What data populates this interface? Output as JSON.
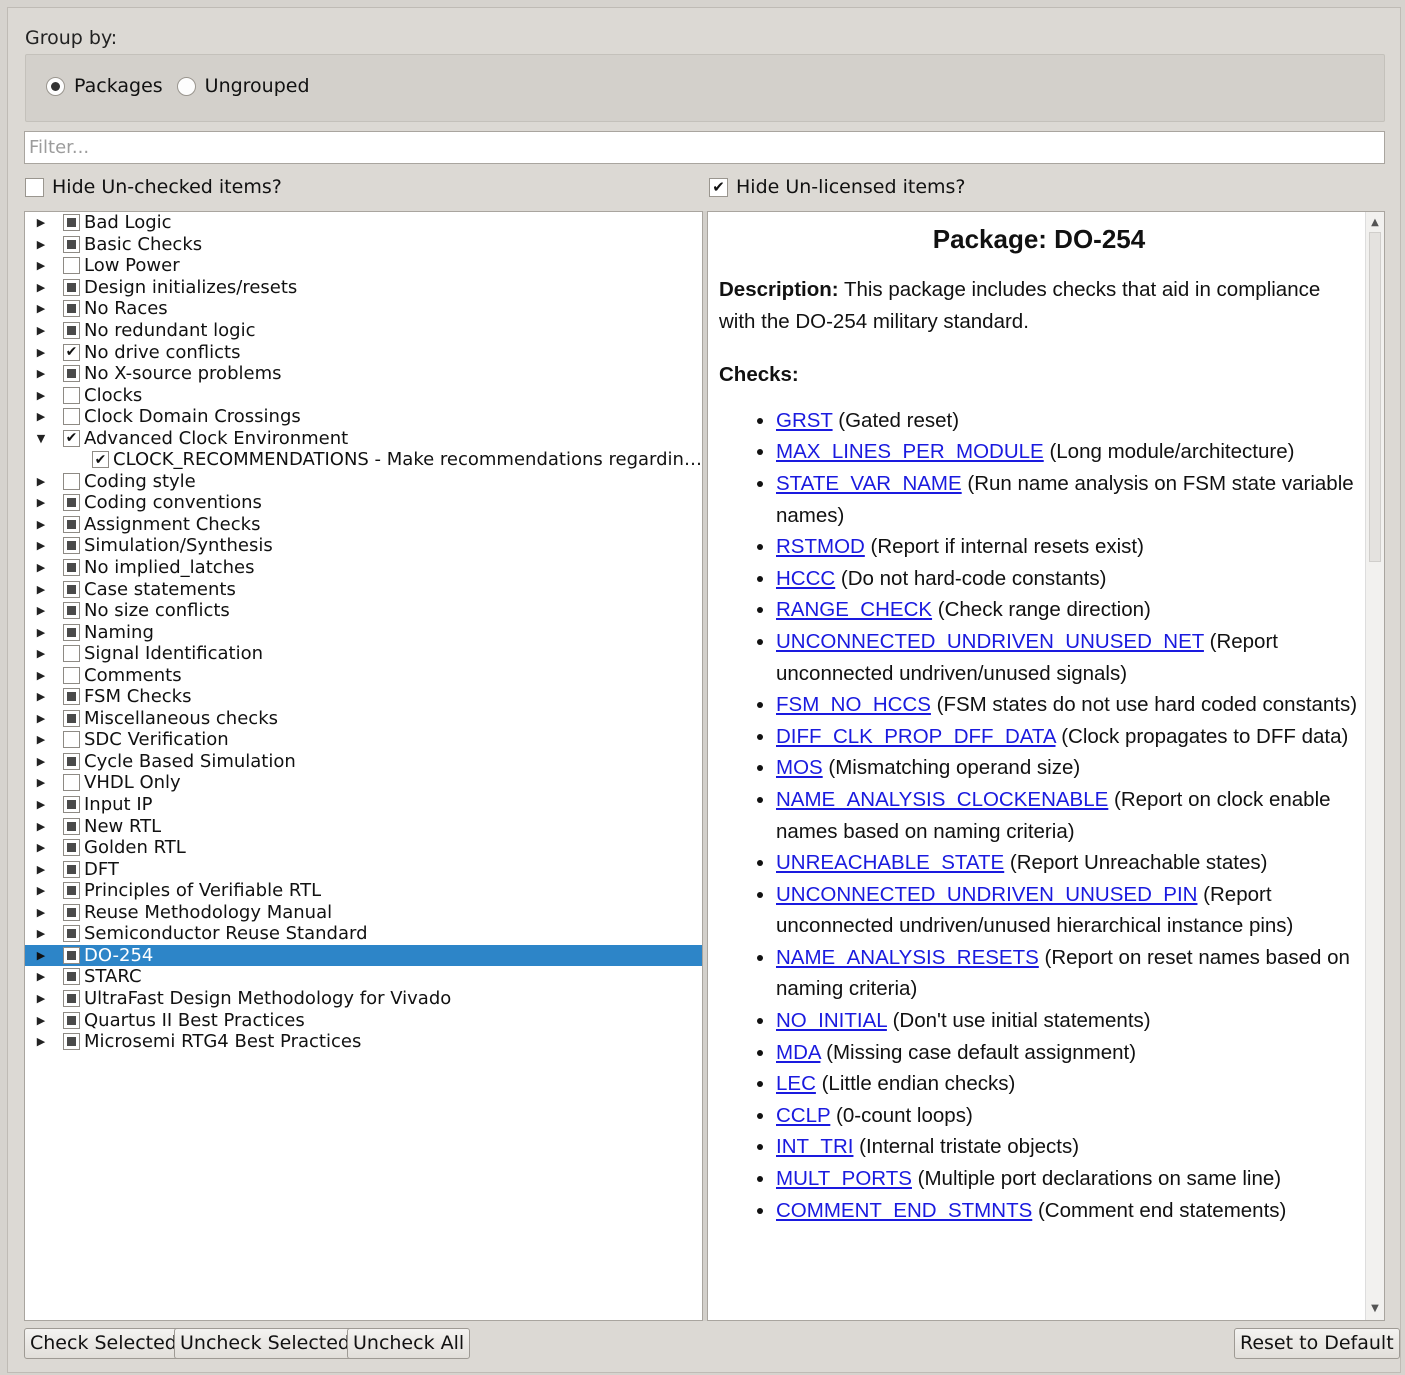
{
  "group_by": {
    "label": "Group by:",
    "options": [
      {
        "label": "Packages",
        "selected": true
      },
      {
        "label": "Ungrouped",
        "selected": false
      }
    ]
  },
  "filter": {
    "placeholder": "Filter...",
    "value": ""
  },
  "hide_unchecked": {
    "label": "Hide Un-checked items?",
    "checked": false
  },
  "hide_unlicensed": {
    "label": "Hide Un-licensed items?",
    "checked": true
  },
  "tree": [
    {
      "label": "Bad Logic",
      "state": "partial",
      "expanded": false
    },
    {
      "label": "Basic Checks",
      "state": "partial",
      "expanded": false
    },
    {
      "label": "Low Power",
      "state": "unchecked",
      "expanded": false
    },
    {
      "label": "Design initializes/resets",
      "state": "partial",
      "expanded": false
    },
    {
      "label": "No Races",
      "state": "partial",
      "expanded": false
    },
    {
      "label": "No redundant logic",
      "state": "partial",
      "expanded": false
    },
    {
      "label": "No drive conflicts",
      "state": "checked",
      "expanded": false
    },
    {
      "label": "No X-source problems",
      "state": "partial",
      "expanded": false
    },
    {
      "label": "Clocks",
      "state": "unchecked",
      "expanded": false
    },
    {
      "label": "Clock Domain Crossings",
      "state": "unchecked",
      "expanded": false
    },
    {
      "label": "Advanced Clock Environment",
      "state": "checked",
      "expanded": true,
      "children": [
        {
          "label": "CLOCK_RECOMMENDATIONS - Make recommendations regardin…",
          "state": "checked"
        }
      ]
    },
    {
      "label": "Coding style",
      "state": "unchecked",
      "expanded": false
    },
    {
      "label": "Coding conventions",
      "state": "partial",
      "expanded": false
    },
    {
      "label": "Assignment Checks",
      "state": "partial",
      "expanded": false
    },
    {
      "label": "Simulation/Synthesis",
      "state": "partial",
      "expanded": false
    },
    {
      "label": "No implied_latches",
      "state": "partial",
      "expanded": false
    },
    {
      "label": "Case statements",
      "state": "partial",
      "expanded": false
    },
    {
      "label": "No size conflicts",
      "state": "partial",
      "expanded": false
    },
    {
      "label": "Naming",
      "state": "partial",
      "expanded": false
    },
    {
      "label": "Signal Identification",
      "state": "unchecked",
      "expanded": false
    },
    {
      "label": "Comments",
      "state": "unchecked",
      "expanded": false
    },
    {
      "label": "FSM Checks",
      "state": "partial",
      "expanded": false
    },
    {
      "label": "Miscellaneous checks",
      "state": "partial",
      "expanded": false
    },
    {
      "label": "SDC Verification",
      "state": "unchecked",
      "expanded": false
    },
    {
      "label": "Cycle Based Simulation",
      "state": "partial",
      "expanded": false
    },
    {
      "label": "VHDL Only",
      "state": "unchecked",
      "expanded": false
    },
    {
      "label": "Input IP",
      "state": "partial",
      "expanded": false
    },
    {
      "label": "New RTL",
      "state": "partial",
      "expanded": false
    },
    {
      "label": "Golden RTL",
      "state": "partial",
      "expanded": false
    },
    {
      "label": "DFT",
      "state": "partial",
      "expanded": false
    },
    {
      "label": "Principles of Verifiable RTL",
      "state": "partial",
      "expanded": false
    },
    {
      "label": "Reuse Methodology Manual",
      "state": "partial",
      "expanded": false
    },
    {
      "label": "Semiconductor Reuse Standard",
      "state": "partial",
      "expanded": false
    },
    {
      "label": "DO-254",
      "state": "partial",
      "expanded": false,
      "selected": true
    },
    {
      "label": "STARC",
      "state": "partial",
      "expanded": false
    },
    {
      "label": "UltraFast Design Methodology for Vivado",
      "state": "partial",
      "expanded": false
    },
    {
      "label": "Quartus II Best Practices",
      "state": "partial",
      "expanded": false
    },
    {
      "label": "Microsemi RTG4 Best Practices",
      "state": "partial",
      "expanded": false
    }
  ],
  "info": {
    "title": "Package: DO-254",
    "description_label": "Description:",
    "description": "This package includes checks that aid in compliance with the DO-254 military standard.",
    "checks_label": "Checks:",
    "checks": [
      {
        "name": "GRST",
        "desc": "(Gated reset)"
      },
      {
        "name": "MAX_LINES_PER_MODULE",
        "desc": "(Long module/architecture)"
      },
      {
        "name": "STATE_VAR_NAME",
        "desc": "(Run name analysis on FSM state variable names)"
      },
      {
        "name": "RSTMOD",
        "desc": "(Report if internal resets exist)"
      },
      {
        "name": "HCCC",
        "desc": "(Do not hard-code constants)"
      },
      {
        "name": "RANGE_CHECK",
        "desc": "(Check range direction)"
      },
      {
        "name": "UNCONNECTED_UNDRIVEN_UNUSED_NET",
        "desc": "(Report unconnected undriven/unused signals)"
      },
      {
        "name": "FSM_NO_HCCS",
        "desc": "(FSM states do not use hard coded constants)"
      },
      {
        "name": "DIFF_CLK_PROP_DFF_DATA",
        "desc": "(Clock propagates to DFF data)"
      },
      {
        "name": "MOS",
        "desc": "(Mismatching operand size)"
      },
      {
        "name": "NAME_ANALYSIS_CLOCKENABLE",
        "desc": "(Report on clock enable names based on naming criteria)"
      },
      {
        "name": "UNREACHABLE_STATE",
        "desc": "(Report Unreachable states)"
      },
      {
        "name": "UNCONNECTED_UNDRIVEN_UNUSED_PIN",
        "desc": "(Report unconnected undriven/unused hierarchical instance pins)"
      },
      {
        "name": "NAME_ANALYSIS_RESETS",
        "desc": "(Report on reset names based on naming criteria)"
      },
      {
        "name": "NO_INITIAL",
        "desc": "(Don't use initial statements)"
      },
      {
        "name": "MDA",
        "desc": "(Missing case default assignment)"
      },
      {
        "name": "LEC",
        "desc": "(Little endian checks)"
      },
      {
        "name": "CCLP",
        "desc": "(0-count loops)"
      },
      {
        "name": "INT_TRI",
        "desc": "(Internal tristate objects)"
      },
      {
        "name": "MULT_PORTS",
        "desc": "(Multiple port declarations on same line)"
      },
      {
        "name": "COMMENT_END_STMNTS",
        "desc": "(Comment end statements)"
      }
    ]
  },
  "buttons": {
    "check_selected": "Check Selected",
    "uncheck_selected": "Uncheck Selected",
    "uncheck_all": "Uncheck All",
    "reset_default": "Reset to Default"
  },
  "colors": {
    "selection": "#2d85c8",
    "link": "#1a1adf",
    "background": "#dcd9d4"
  }
}
